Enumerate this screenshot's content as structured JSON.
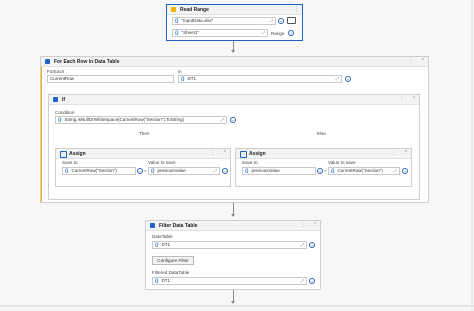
{
  "read_range": {
    "title": "Read Range",
    "workbook_value": "\"InputData.xlsx\"",
    "sheet_value": "\"Sheet1\"",
    "range_label": "Range"
  },
  "for_each": {
    "title": "For Each Row in Data Table",
    "foreach_label": "ForEach",
    "foreach_value": "CurrentRow",
    "in_label": "in",
    "in_value": "DT1"
  },
  "if_block": {
    "title": "If",
    "condition_label": "Condition",
    "condition_value": "String.IsNullOrWhiteSpace(CurrentRow(\"Section\").ToString)",
    "then_label": "Then",
    "else_label": "Else"
  },
  "assign_then": {
    "title": "Assign",
    "save_to_label": "Save to",
    "value_label": "Value to save",
    "save_to_value": "CurrentRow(\"Section\")",
    "value_value": "previousValue"
  },
  "assign_else": {
    "title": "Assign",
    "save_to_label": "Save to",
    "value_label": "Value to save",
    "save_to_value": "previousValue",
    "value_value": "CurrentRow(\"Section\")"
  },
  "filter": {
    "title": "Filter Data Table",
    "datatable_label": "DataTable",
    "datatable_value": "DT1",
    "configure_button": "Configure Filter",
    "filtered_label": "Filtered DataTable",
    "filtered_value": "DT1"
  },
  "glyphs": {
    "brace": "{}",
    "plus": "+",
    "equals": "=",
    "dots": "⋮",
    "collapse": "⌃",
    "expand": "⤢"
  }
}
